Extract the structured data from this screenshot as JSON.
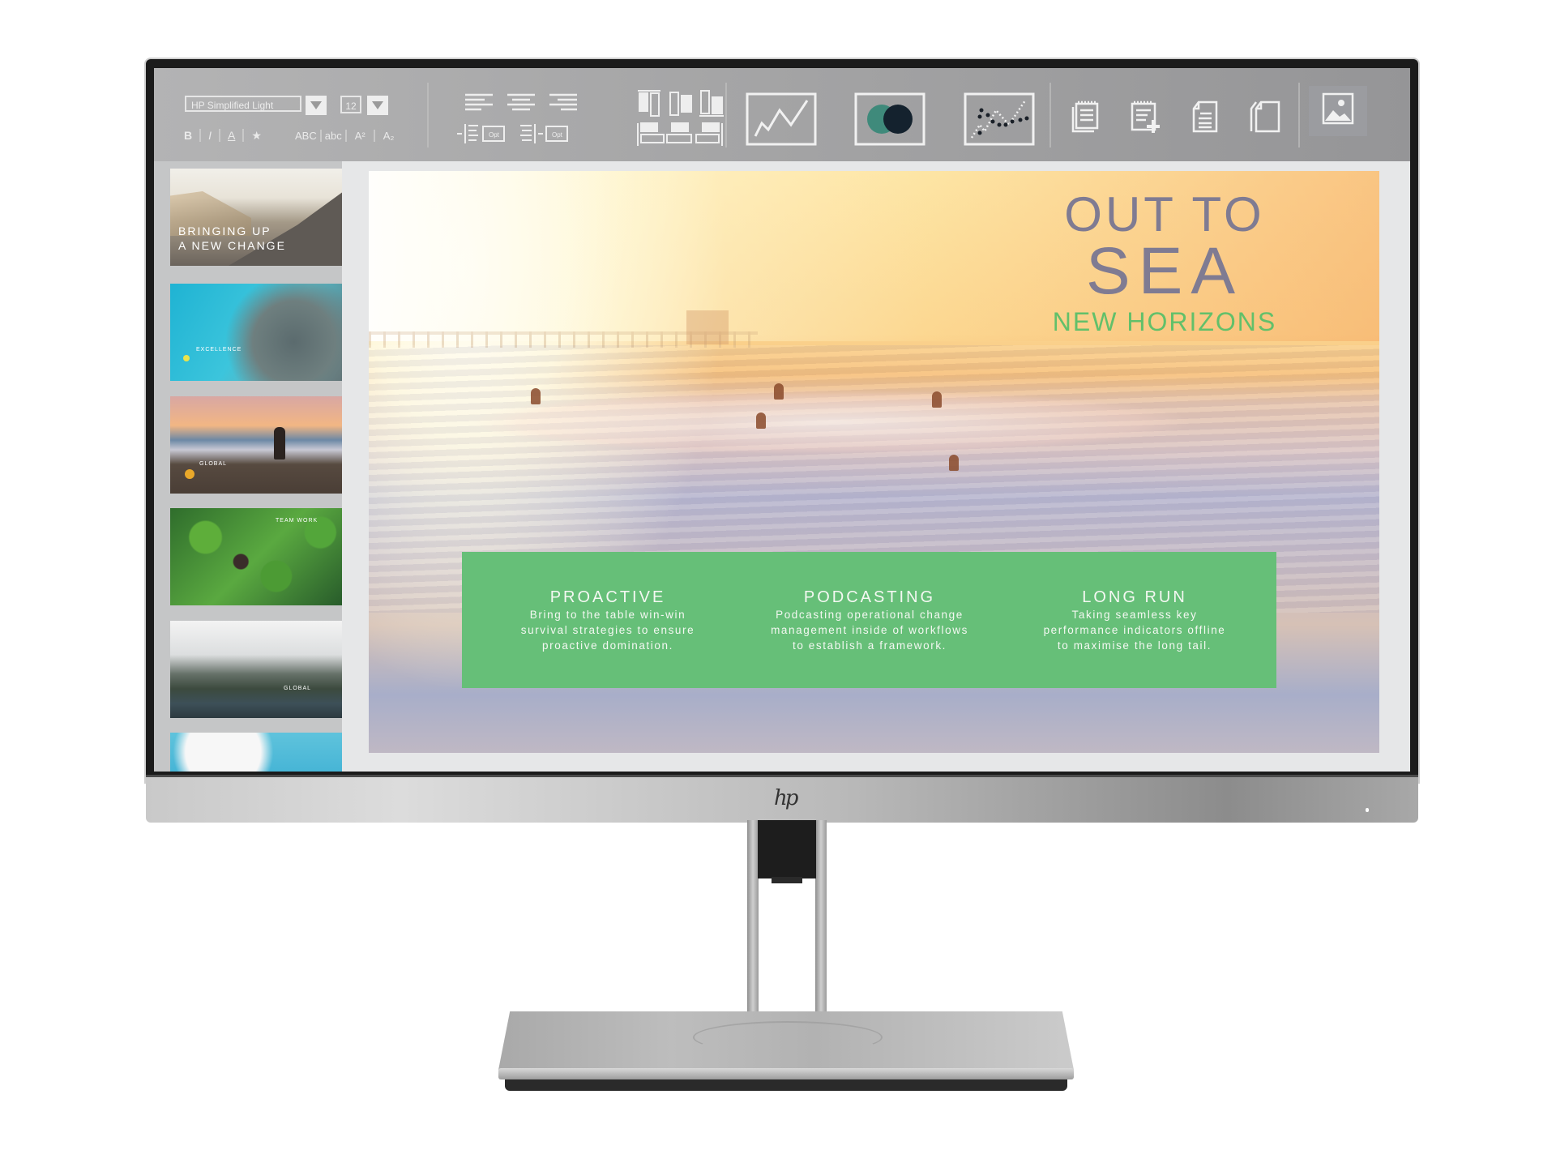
{
  "app": {
    "type": "presentation-editor",
    "device_brand_logo": "hp"
  },
  "toolbar": {
    "font_family": "HP Simplified Light",
    "font_size": "12",
    "font_dropdown_icon": "triangle-down-icon",
    "size_dropdown_icon": "triangle-down-icon",
    "format_buttons": [
      {
        "label": "B",
        "name": "bold"
      },
      {
        "label": "I",
        "name": "italic"
      },
      {
        "label": "A",
        "name": "underline"
      },
      {
        "label": "★",
        "name": "highlight"
      }
    ],
    "case_buttons": [
      {
        "label": "ABC",
        "name": "uppercase"
      },
      {
        "label": "abc",
        "name": "lowercase"
      },
      {
        "label": "A²",
        "name": "superscript"
      },
      {
        "label": "A₂",
        "name": "subscript"
      }
    ],
    "align_buttons": [
      "align-left",
      "align-center",
      "align-right"
    ],
    "indent_buttons": [
      {
        "name": "indent-increase",
        "label": "Opt"
      },
      {
        "name": "indent-decrease",
        "label": "Opt"
      }
    ],
    "arrange_buttons": [
      "align-top",
      "align-middle",
      "align-bottom",
      "distribute-left",
      "distribute-center",
      "distribute-right"
    ],
    "chart_buttons": [
      "line-chart",
      "venn-chart",
      "scatter-chart"
    ],
    "venn_colors": {
      "left": "#3f8a7b",
      "right": "#14222e"
    },
    "page_buttons": [
      "notes-stack",
      "add-note",
      "document",
      "copy-page"
    ],
    "insert_image_button": "image"
  },
  "sidebar": {
    "slides": [
      {
        "title": "BRINGING UP\nA NEW CHANGE",
        "line1": "BRINGING UP",
        "line2": "A NEW CHANGE",
        "caption": ""
      },
      {
        "title": "",
        "caption": "EXCELLENCE"
      },
      {
        "title": "",
        "caption": "GLOBAL"
      },
      {
        "title": "",
        "caption": "TEAM WORK"
      },
      {
        "title": "",
        "caption": "GLOBAL"
      },
      {
        "title": "",
        "caption": ""
      }
    ]
  },
  "slide": {
    "title_line1": "OUT TO",
    "title_line2": "SEA",
    "subtitle": "NEW HORIZONS",
    "colors": {
      "title": "#7f7b92",
      "subtitle": "#62c06a",
      "band": "#66bf78"
    },
    "columns": [
      {
        "heading": "PROACTIVE",
        "lines": [
          "Bring to the table win-win",
          "survival strategies to ensure",
          "proactive domination."
        ]
      },
      {
        "heading": "PODCASTING",
        "lines": [
          "Podcasting operational change",
          "management inside of workflows",
          "to establish a framework."
        ]
      },
      {
        "heading": "LONG RUN",
        "lines": [
          "Taking seamless key",
          "performance indicators offline",
          "to maximise the long tail."
        ]
      }
    ]
  }
}
